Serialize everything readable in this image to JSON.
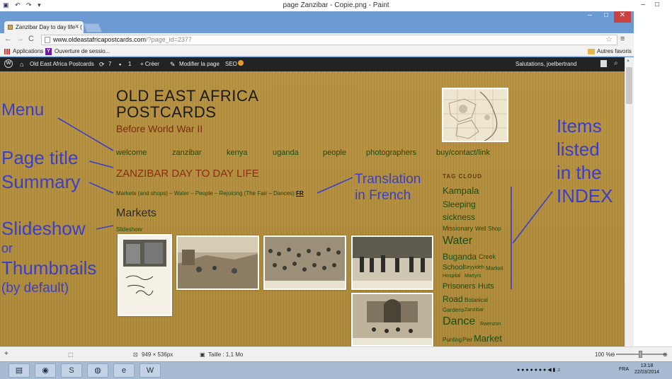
{
  "paint": {
    "title": "page Zanzibar - Copie.png - Paint",
    "status": {
      "dimensions": "949 × 536px",
      "size": "Taille : 1,1 Mo",
      "zoom": "100 %"
    }
  },
  "browser": {
    "tab_title": "Zanzibar Day to day life - (",
    "url_host": "www.oldeastafricapostcards.com",
    "url_path": "/?page_id=2377",
    "bookmarks": {
      "apps": "Applications",
      "session": "Ouverture de sessio...",
      "other": "Autres favoris"
    }
  },
  "wp_admin": {
    "site": "Old East Africa Postcards",
    "updates": "7",
    "comments": "1",
    "new": "+ Créer",
    "edit": "Modifier la page",
    "seo": "SEO",
    "greeting": "Salutations, joelbertrand"
  },
  "site": {
    "title_line1": "OLD EAST AFRICA",
    "title_line2": "POSTCARDS",
    "subtitle": "Before World War II",
    "menu": [
      "welcome",
      "zanzibar",
      "kenya",
      "uganda",
      "people",
      "photographers",
      "buy/contact/link"
    ],
    "page_title": "ZANZIBAR DAY TO DAY LIFE",
    "summary": "Markets (and shops) – Water – People – Rejoicing (The Fair – Dances)",
    "summary_fr": "FR",
    "section_heading": "Markets",
    "slideshow": "Slideshow"
  },
  "tag_cloud": {
    "heading": "TAG CLOUD",
    "tags": [
      "Kampala",
      "Sleeping",
      "sickness",
      "Missionary",
      "Well",
      "Shop",
      "Water",
      "Buganda",
      "Creek",
      "School",
      "Seyyideh",
      "Market",
      "Hospital",
      "Martyrs",
      "Prisoners",
      "Huts",
      "Road",
      "Botanical",
      "Gardens",
      "Zanzibar",
      "Dance",
      "Rwenzori",
      "Punting",
      "Pier",
      "Market"
    ]
  },
  "annotations": {
    "menu": "Menu",
    "page_title": "Page title",
    "summary": "Summary",
    "slideshow": "Slideshow",
    "or": "or",
    "thumbnails": "Thumbnails",
    "by_default": "(by default)",
    "translation_1": "Translation",
    "translation_2": "in French",
    "index_1": "Items",
    "index_2": "listed",
    "index_3": "in the",
    "index_4": "INDEX"
  },
  "taskbar": {
    "lang": "FRA",
    "time": "13:18",
    "date": "22/03/2014"
  },
  "colors": {
    "annotation": "#3b3fc7",
    "link_green": "#1f4a10",
    "title_red": "#8b2e0f",
    "kraft_background": "#b89442"
  }
}
